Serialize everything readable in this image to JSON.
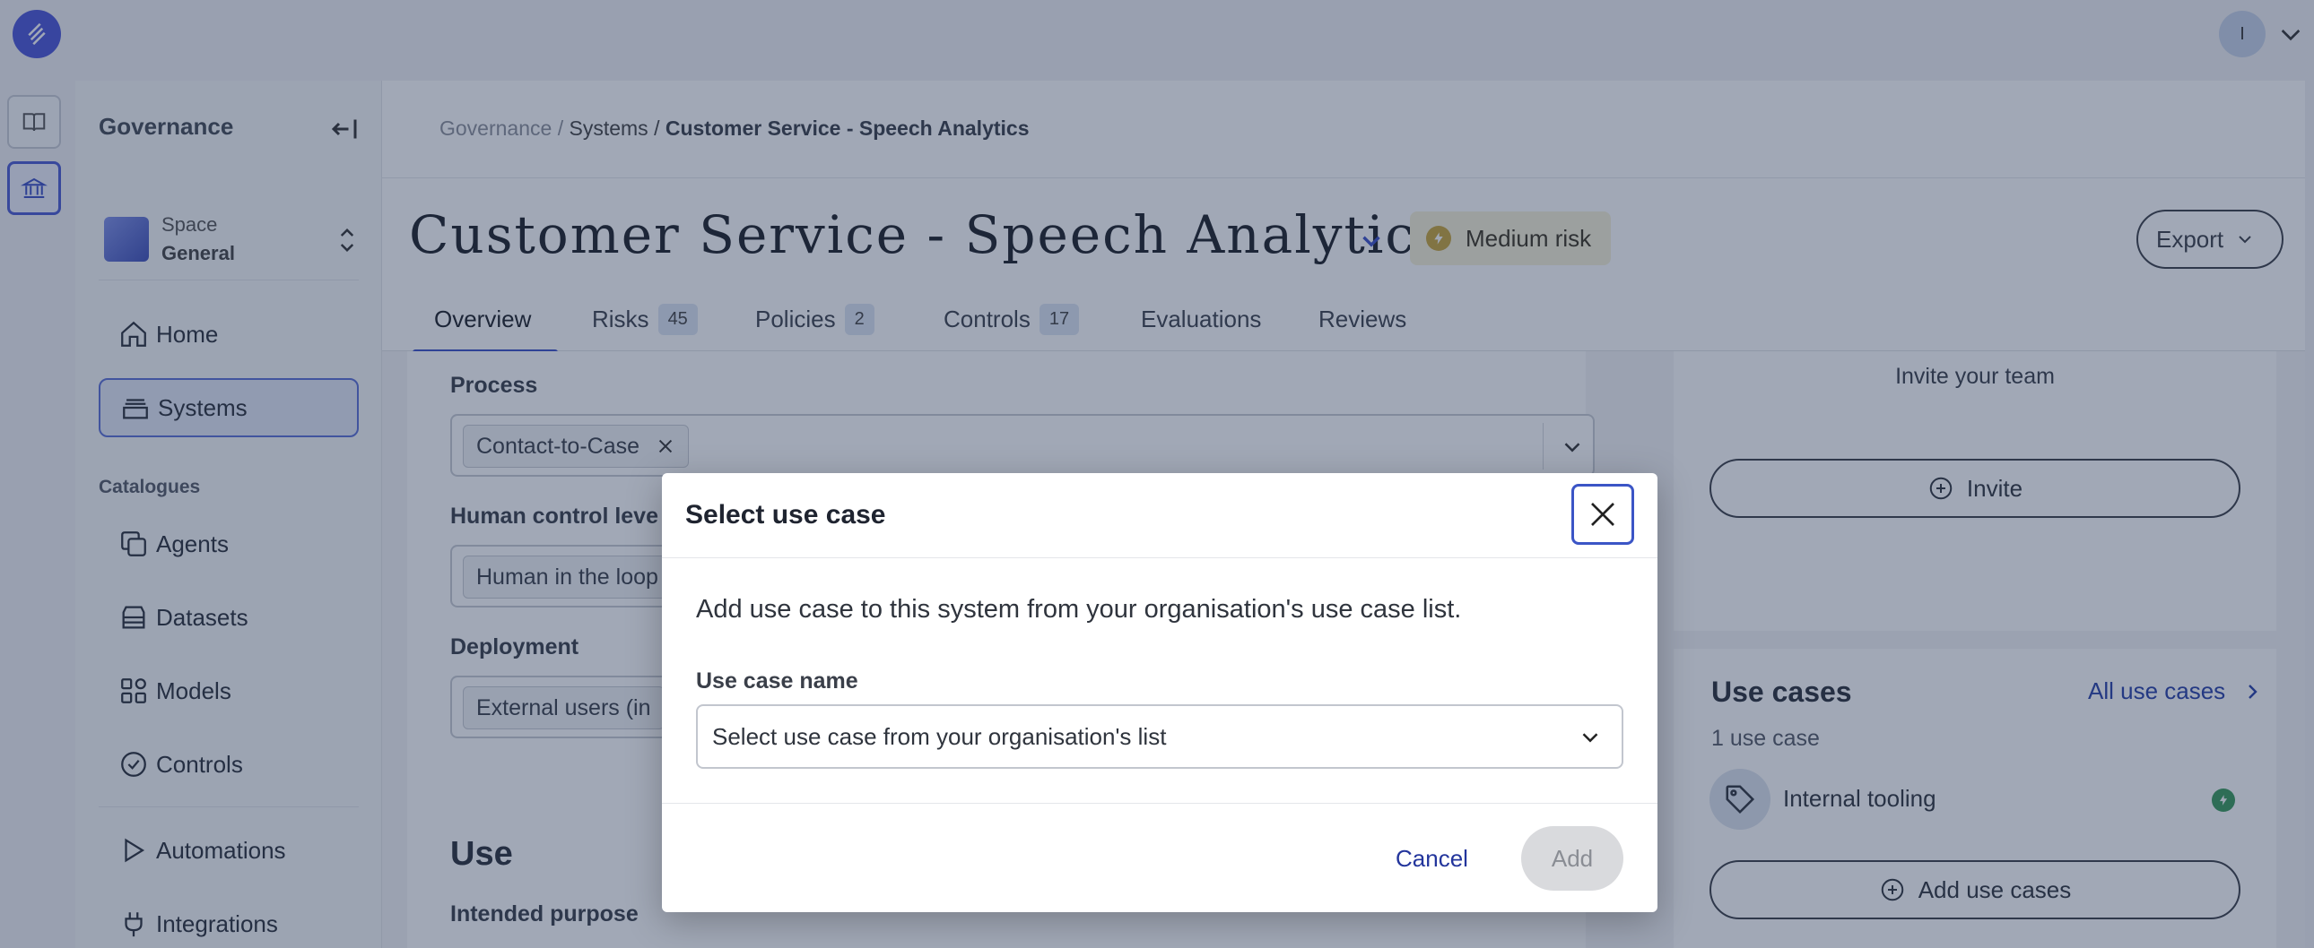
{
  "sidebar": {
    "title": "Governance",
    "space_label": "Space",
    "space_name": "General",
    "nav": [
      {
        "label": "Home",
        "icon": "home-icon"
      },
      {
        "label": "Systems",
        "icon": "stack-icon"
      }
    ],
    "catalogues_heading": "Catalogues",
    "catalogues": [
      {
        "label": "Agents",
        "icon": "copy-icon"
      },
      {
        "label": "Datasets",
        "icon": "database-icon"
      },
      {
        "label": "Models",
        "icon": "grid-icon"
      },
      {
        "label": "Controls",
        "icon": "check-circle-icon"
      },
      {
        "label": "Automations",
        "icon": "play-icon"
      },
      {
        "label": "Integrations",
        "icon": "plug-icon"
      }
    ]
  },
  "user": {
    "avatar_initial": "I"
  },
  "breadcrumb": {
    "root": "Governance",
    "section": "Systems",
    "current": "Customer Service - Speech Analytics",
    "sep": "/"
  },
  "header": {
    "title": "Customer Service - Speech Analytics",
    "risk_badge": "Medium risk",
    "export_label": "Export"
  },
  "tabs": [
    {
      "label": "Overview",
      "count": ""
    },
    {
      "label": "Risks",
      "count": "45"
    },
    {
      "label": "Policies",
      "count": "2"
    },
    {
      "label": "Controls",
      "count": "17"
    },
    {
      "label": "Evaluations",
      "count": ""
    },
    {
      "label": "Reviews",
      "count": ""
    }
  ],
  "form": {
    "process_label": "Process",
    "process_chip": "Contact-to-Case",
    "human_control_label": "Human control leve",
    "human_control_chip": "Human in the loop",
    "deployment_label": "Deployment",
    "deployment_chip": "External users (in",
    "use_heading": "Use",
    "intended_purpose_label": "Intended purpose"
  },
  "team_card": {
    "text": "Invite your team",
    "invite_label": "Invite"
  },
  "use_cases": {
    "title": "Use cases",
    "all_link": "All use cases",
    "count": "1 use case",
    "items": [
      {
        "name": "Internal tooling"
      }
    ],
    "add_label": "Add use cases"
  },
  "modal": {
    "title": "Select use case",
    "description": "Add use case to this system from your organisation's use case list.",
    "field_label": "Use case name",
    "select_placeholder": "Select use case from your organisation's list",
    "cancel_label": "Cancel",
    "add_label": "Add"
  },
  "colors": {
    "accent": "#3c50c8",
    "risk_medium": "#c9a53a",
    "status_ok": "#3a9a5a"
  }
}
